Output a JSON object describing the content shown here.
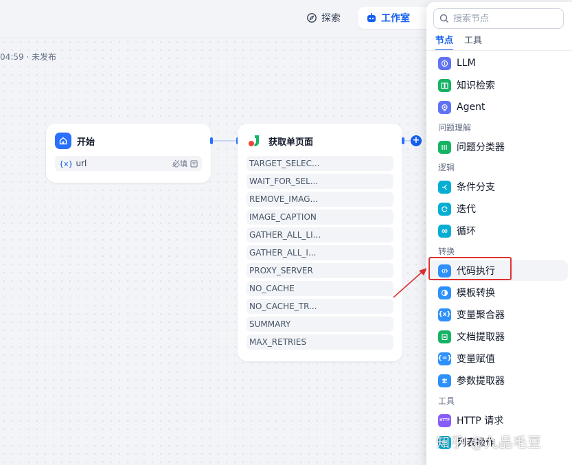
{
  "header": {
    "explore_label": "探索",
    "studio_label": "工作室",
    "status": "04:59 · 未发布"
  },
  "nodes": {
    "start": {
      "title": "开始",
      "var_symbol": "{x}",
      "var_name": "url",
      "required_label": "必填"
    },
    "scrape": {
      "title": "获取单页面",
      "params": [
        "TARGET_SELEC...",
        "WAIT_FOR_SEL...",
        "REMOVE_IMAG...",
        "IMAGE_CAPTION",
        "GATHER_ALL_LI...",
        "GATHER_ALL_I...",
        "PROXY_SERVER",
        "NO_CACHE",
        "NO_CACHE_TR...",
        "SUMMARY",
        "MAX_RETRIES"
      ]
    }
  },
  "panel": {
    "search_placeholder": "搜索节点",
    "tabs": [
      "节点",
      "工具"
    ],
    "items": {
      "llm": "LLM",
      "knowledge": "知识检索",
      "agent": "Agent",
      "group_understanding": "问题理解",
      "classifier": "问题分类器",
      "group_logic": "逻辑",
      "if_else": "条件分支",
      "iteration": "迭代",
      "loop": "循环",
      "group_transform": "转换",
      "code": "代码执行",
      "template": "模板转换",
      "aggregator": "变量聚合器",
      "doc_extractor": "文档提取器",
      "assigner": "变量赋值",
      "param_extractor": "参数提取器",
      "group_tools": "工具",
      "http": "HTTP 请求",
      "list_op": "列表操作"
    },
    "http_badge": "HTTP"
  },
  "watermark": "知乎 @九品毛豆",
  "colors": {
    "primary": "#155eef",
    "highlight": "#e03131"
  }
}
